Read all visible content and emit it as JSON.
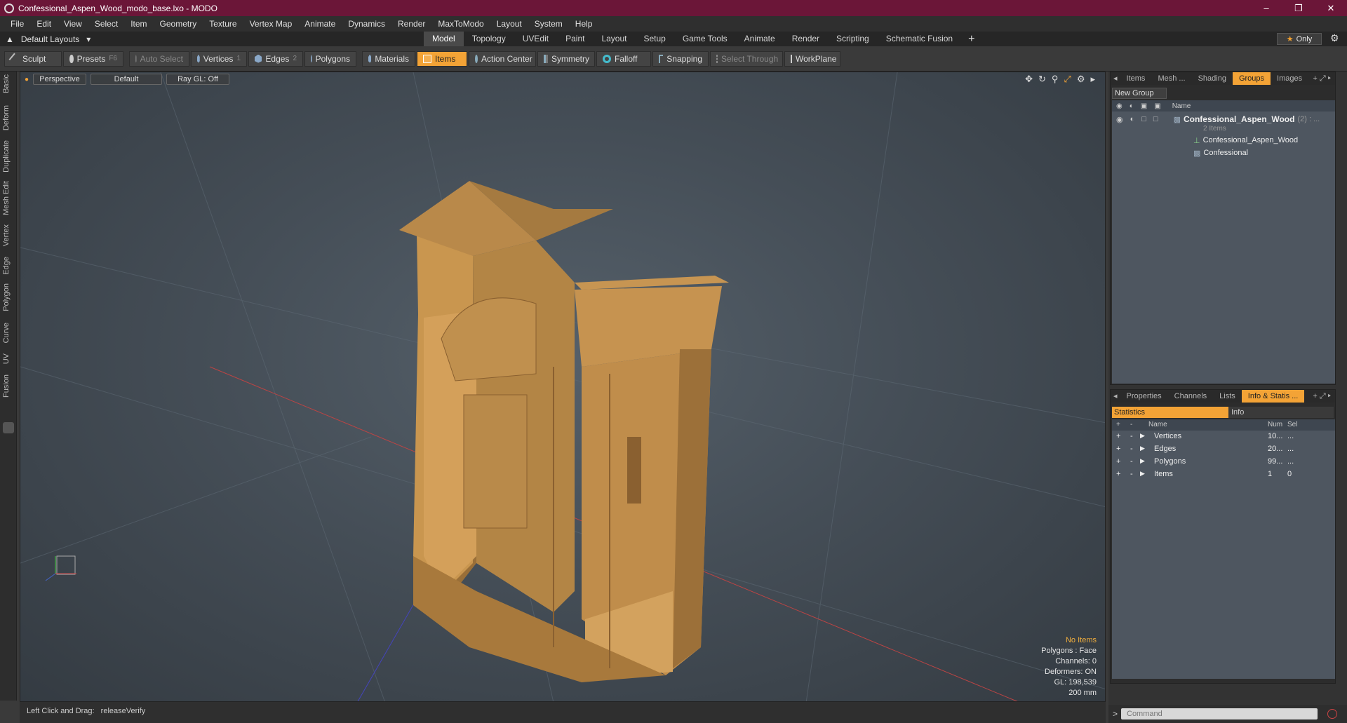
{
  "title": "Confessional_Aspen_Wood_modo_base.lxo - MODO",
  "menu": [
    "File",
    "Edit",
    "View",
    "Select",
    "Item",
    "Geometry",
    "Texture",
    "Vertex Map",
    "Animate",
    "Dynamics",
    "Render",
    "MaxToModo",
    "Layout",
    "System",
    "Help"
  ],
  "layouts_label": "Default Layouts",
  "layout_tabs": [
    "Model",
    "Topology",
    "UVEdit",
    "Paint",
    "Layout",
    "Setup",
    "Game Tools",
    "Animate",
    "Render",
    "Scripting",
    "Schematic Fusion"
  ],
  "only_label": "Only",
  "toolbar": {
    "sculpt": "Sculpt",
    "presets": "Presets",
    "presets_key": "F6",
    "auto_select": "Auto Select",
    "vertices": "Vertices",
    "vertices_key": "1",
    "edges": "Edges",
    "edges_key": "2",
    "polygons": "Polygons",
    "materials": "Materials",
    "items": "Items",
    "action_center": "Action Center",
    "symmetry": "Symmetry",
    "falloff": "Falloff",
    "snapping": "Snapping",
    "select_through": "Select Through",
    "workplane": "WorkPlane"
  },
  "left_tabs": [
    "Basic",
    "Deform",
    "Duplicate",
    "Mesh Edit",
    "Vertex",
    "Edge",
    "Polygon",
    "Curve",
    "UV",
    "Fusion"
  ],
  "viewport": {
    "perspective": "Perspective",
    "default": "Default",
    "raygl": "Ray GL: Off",
    "info": {
      "no_items": "No Items",
      "polygons": "Polygons : Face",
      "channels": "Channels: 0",
      "deformers": "Deformers: ON",
      "gl": "GL: 198,539",
      "scale": "200 mm"
    }
  },
  "groups_panel": {
    "tabs": [
      "Items",
      "Mesh ...",
      "Shading",
      "Groups",
      "Images"
    ],
    "active_tab": "Groups",
    "new_group": "New Group",
    "col_name": "Name",
    "group_name": "Confessional_Aspen_Wood",
    "group_count": "(2) : ...",
    "group_sub": "2 Items",
    "children": [
      "Confessional_Aspen_Wood",
      "Confessional"
    ]
  },
  "stats_panel": {
    "tabs": [
      "Properties",
      "Channels",
      "Lists",
      "Info & Statis ..."
    ],
    "active_tab": "Info & Statis ...",
    "sub_tabs": [
      "Statistics",
      "Info"
    ],
    "cols": [
      "Name",
      "Num",
      "Sel"
    ],
    "rows": [
      {
        "name": "Vertices",
        "num": "10...",
        "sel": "..."
      },
      {
        "name": "Edges",
        "num": "20...",
        "sel": "..."
      },
      {
        "name": "Polygons",
        "num": "99...",
        "sel": "..."
      },
      {
        "name": "Items",
        "num": "1",
        "sel": "0"
      }
    ]
  },
  "command_placeholder": "Command",
  "status": {
    "label": "Left Click and Drag:",
    "command": "releaseVerify"
  },
  "colors": {
    "title_bar": "#6b1638",
    "accent": "#f3a336",
    "wood": "#c9964f"
  }
}
